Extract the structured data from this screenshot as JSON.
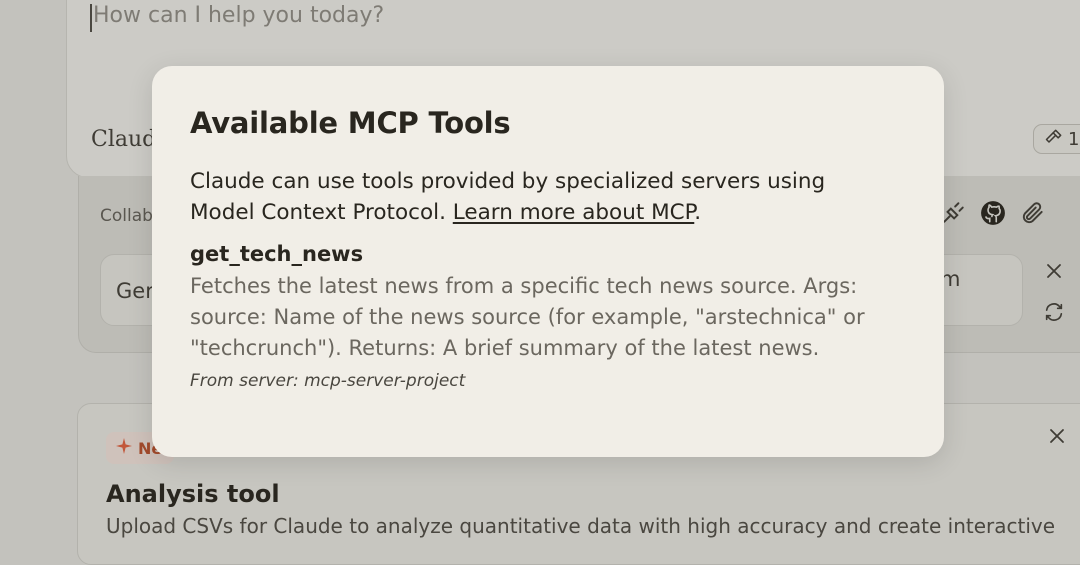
{
  "composer": {
    "placeholder": "How can I help you today?",
    "model_label": "Claude",
    "tools_count": "1"
  },
  "project_panel": {
    "collab_label": "Collab",
    "suggestion_text": "Ger",
    "suggestion_tail": "m"
  },
  "analysis_card": {
    "badge_label": "Ne",
    "title": "Analysis tool",
    "description": "Upload CSVs for Claude to analyze quantitative data with high accuracy and create interactive"
  },
  "modal": {
    "title": "Available MCP Tools",
    "intro": "Claude can use tools provided by specialized servers using Model Context Protocol.",
    "link_text": "Learn more about MCP",
    "intro_end": ".",
    "tools": [
      {
        "name": "get_tech_news",
        "description": "Fetches the latest news from a specific tech news source. Args: source: Name of the news source (for example, \"arstechnica\" or \"techcrunch\"). Returns: A brief summary of the latest news.",
        "server": "From server: mcp-server-project"
      }
    ]
  },
  "colors": {
    "modal_bg": "#f1eee7",
    "text_primary": "#29261f",
    "text_secondary": "#6b675f",
    "accent": "#a24a2b"
  },
  "icons": [
    "hammer-icon",
    "plug-icon",
    "github-icon",
    "paperclip-icon",
    "close-icon",
    "refresh-icon",
    "sparkle-icon"
  ]
}
